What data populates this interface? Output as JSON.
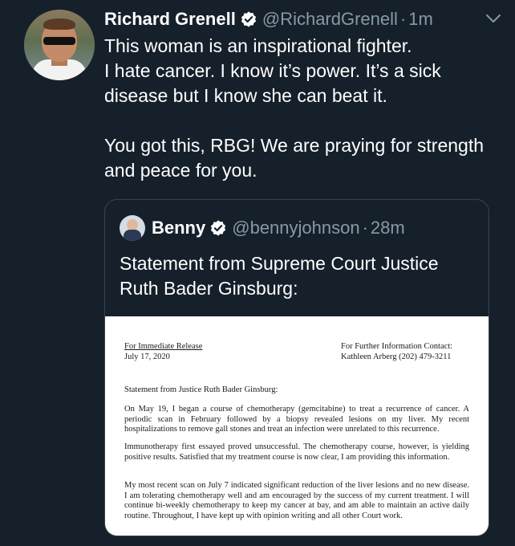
{
  "tweet": {
    "author_name": "Richard Grenell",
    "author_handle": "@RichardGrenell",
    "separator": "·",
    "time": "1m",
    "text": "This woman is an inspirational fighter.\nI hate cancer. I know it’s power. It’s a sick disease but I know she can beat it.\n\nYou got this, RBG! We are praying for strength and peace for you."
  },
  "quoted_tweet": {
    "author_name": "Benny",
    "author_handle": "@bennyjohnson",
    "separator": "·",
    "time": "28m",
    "text": "Statement from Supreme Court Justice Ruth Bader Ginsburg:"
  },
  "document": {
    "release_label": "For Immediate Release",
    "release_date": "July 17, 2020",
    "contact_label": "For Further Information Contact:",
    "contact_value": "Kathleen Arberg (202) 479-3211",
    "heading": "Statement from Justice Ruth Bader Ginsburg:",
    "paragraph_1": "On May 19, I began a course of chemotherapy (gemcitabine) to treat a recurrence of cancer. A periodic scan in February followed by a biopsy revealed lesions on my liver. My recent hospitalizations to remove gall stones and treat an infection were unrelated to this recurrence.",
    "paragraph_2": "Immunotherapy first essayed proved unsuccessful. The chemotherapy course, however, is yielding positive results. Satisfied that my treatment course is now clear, I am providing this information.",
    "paragraph_3": "My most recent scan on July 7 indicated significant reduction of the liver lesions and no new disease. I am tolerating chemotherapy well and am encouraged by the success of my current treatment. I will continue bi-weekly chemotherapy to keep my cancer at bay, and am able to maintain an active daily routine. Throughout, I have kept up with opinion writing and all other Court work."
  },
  "colors": {
    "background": "#15202b",
    "text": "#ffffff",
    "secondary_text": "#8899a6",
    "verified": "#ffffff",
    "border": "#38444d"
  },
  "icons": {
    "verified": "verified-badge-icon",
    "menu": "chevron-down-icon"
  }
}
